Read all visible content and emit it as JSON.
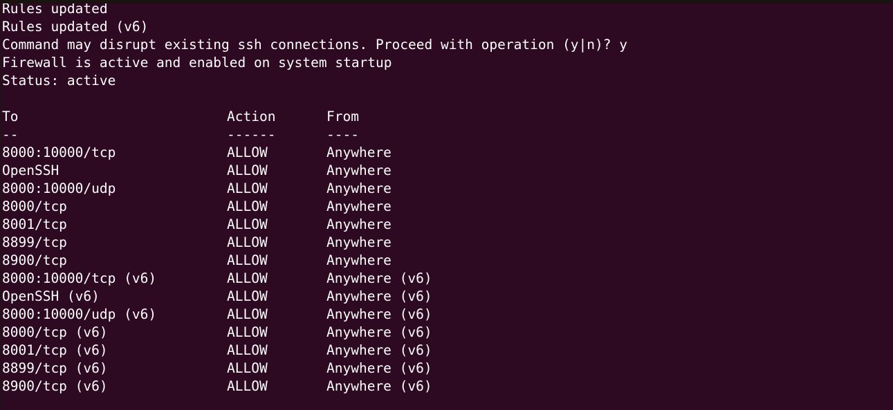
{
  "terminal": {
    "background_color": "#2d0922",
    "text_color": "#ffffff",
    "messages": [
      "Rules updated",
      "Rules updated (v6)",
      "Command may disrupt existing ssh connections. Proceed with operation (y|n)? y",
      "Firewall is active and enabled on system startup",
      "Status: active"
    ],
    "table": {
      "headers": {
        "to": "To",
        "action": "Action",
        "from": "From"
      },
      "separators": {
        "to": "--",
        "action": "------",
        "from": "----"
      },
      "rows": [
        {
          "to": "8000:10000/tcp",
          "action": "ALLOW",
          "from": "Anywhere"
        },
        {
          "to": "OpenSSH",
          "action": "ALLOW",
          "from": "Anywhere"
        },
        {
          "to": "8000:10000/udp",
          "action": "ALLOW",
          "from": "Anywhere"
        },
        {
          "to": "8000/tcp",
          "action": "ALLOW",
          "from": "Anywhere"
        },
        {
          "to": "8001/tcp",
          "action": "ALLOW",
          "from": "Anywhere"
        },
        {
          "to": "8899/tcp",
          "action": "ALLOW",
          "from": "Anywhere"
        },
        {
          "to": "8900/tcp",
          "action": "ALLOW",
          "from": "Anywhere"
        },
        {
          "to": "8000:10000/tcp (v6)",
          "action": "ALLOW",
          "from": "Anywhere (v6)"
        },
        {
          "to": "OpenSSH (v6)",
          "action": "ALLOW",
          "from": "Anywhere (v6)"
        },
        {
          "to": "8000:10000/udp (v6)",
          "action": "ALLOW",
          "from": "Anywhere (v6)"
        },
        {
          "to": "8000/tcp (v6)",
          "action": "ALLOW",
          "from": "Anywhere (v6)"
        },
        {
          "to": "8001/tcp (v6)",
          "action": "ALLOW",
          "from": "Anywhere (v6)"
        },
        {
          "to": "8899/tcp (v6)",
          "action": "ALLOW",
          "from": "Anywhere (v6)"
        },
        {
          "to": "8900/tcp (v6)",
          "action": "ALLOW",
          "from": "Anywhere (v6)"
        }
      ]
    }
  }
}
